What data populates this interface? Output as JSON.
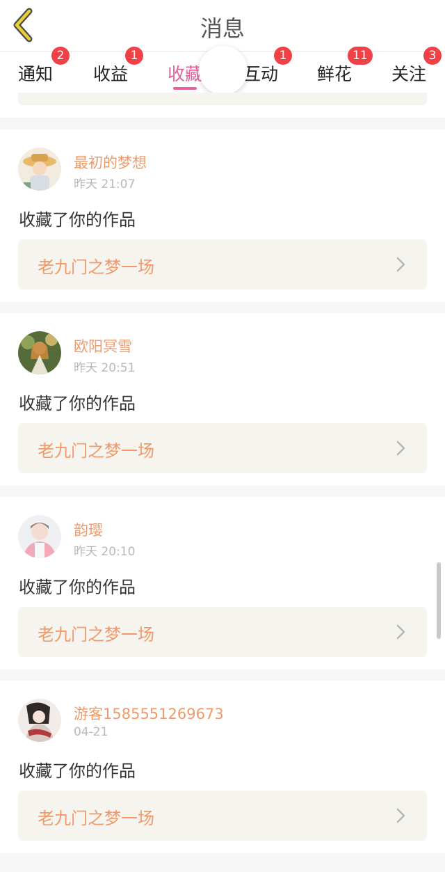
{
  "header": {
    "title": "消息",
    "back_icon": "back-chevron-icon"
  },
  "tabs": [
    {
      "label": "通知",
      "badge": "2",
      "active": false
    },
    {
      "label": "收益",
      "badge": "1",
      "active": false
    },
    {
      "label": "收藏",
      "badge": "",
      "active": true
    },
    {
      "label": "互动",
      "badge": "1",
      "active": false
    },
    {
      "label": "鲜花",
      "badge": "11",
      "active": false
    },
    {
      "label": "关注",
      "badge": "3",
      "active": false
    }
  ],
  "notifications": [
    {
      "username": "最初的梦想",
      "time": "昨天 21:07",
      "message": "收藏了你的作品",
      "work_title": "老九门之梦一场"
    },
    {
      "username": "欧阳冥雪",
      "time": "昨天 20:51",
      "message": "收藏了你的作品",
      "work_title": "老九门之梦一场"
    },
    {
      "username": "韵璎",
      "time": "昨天 20:10",
      "message": "收藏了你的作品",
      "work_title": "老九门之梦一场"
    },
    {
      "username": "游客1585551269673",
      "time": "04-21",
      "message": "收藏了你的作品",
      "work_title": "老九门之梦一场"
    }
  ],
  "colors": {
    "accent": "#e5609b",
    "name": "#ef9a6a",
    "badge": "#f04146",
    "link_bg": "#f5f4ee"
  }
}
